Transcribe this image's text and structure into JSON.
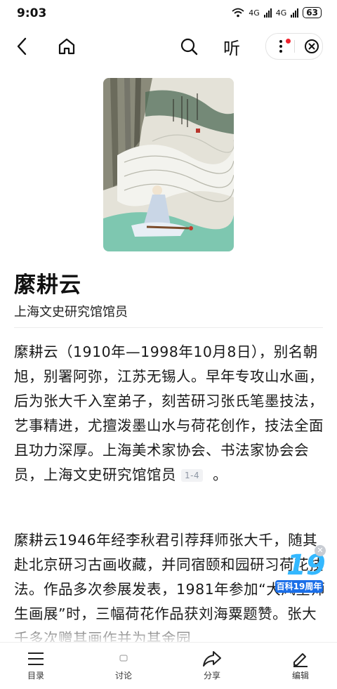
{
  "status": {
    "time": "9:03",
    "net1": "4G",
    "net2": "4G",
    "battery": "63"
  },
  "nav": {
    "listen_label": "听"
  },
  "entry": {
    "title": "縻耕云",
    "subtitle": "上海文史研究馆馆员"
  },
  "content": {
    "para1": "縻耕云（1910年—1998年10月8日），别名朝旭，别署阿弥，江苏无锡人。早年专攻山水画，后为张大千入室弟子，刻苦研习张氏笔墨技法，艺事精进，尤擅泼墨山水与荷花创作，技法全面且功力深厚。上海美术家协会、书法家协会会员，上海文史研究馆馆员",
    "para1_ref": "1-4",
    "para1_end": "。",
    "para2": "縻耕云1946年经李秋君引荐拜师张大千，随其赴北京研习古画收藏，并同宿颐和园研习荷花技法。作品多次参展发表，1981年参加“大风堂师生画展”时，三幅荷花作品获刘海粟题赞。张大千多次赠其画作并为其金园"
  },
  "badge": {
    "number": "19",
    "label": "百科19周年"
  },
  "bottom_bar": {
    "tabs": [
      {
        "label": "目录",
        "icon": "menu-icon"
      },
      {
        "label": "讨论",
        "icon": "comment-icon"
      },
      {
        "label": "分享",
        "icon": "share-icon"
      },
      {
        "label": "编辑",
        "icon": "edit-icon"
      }
    ]
  }
}
